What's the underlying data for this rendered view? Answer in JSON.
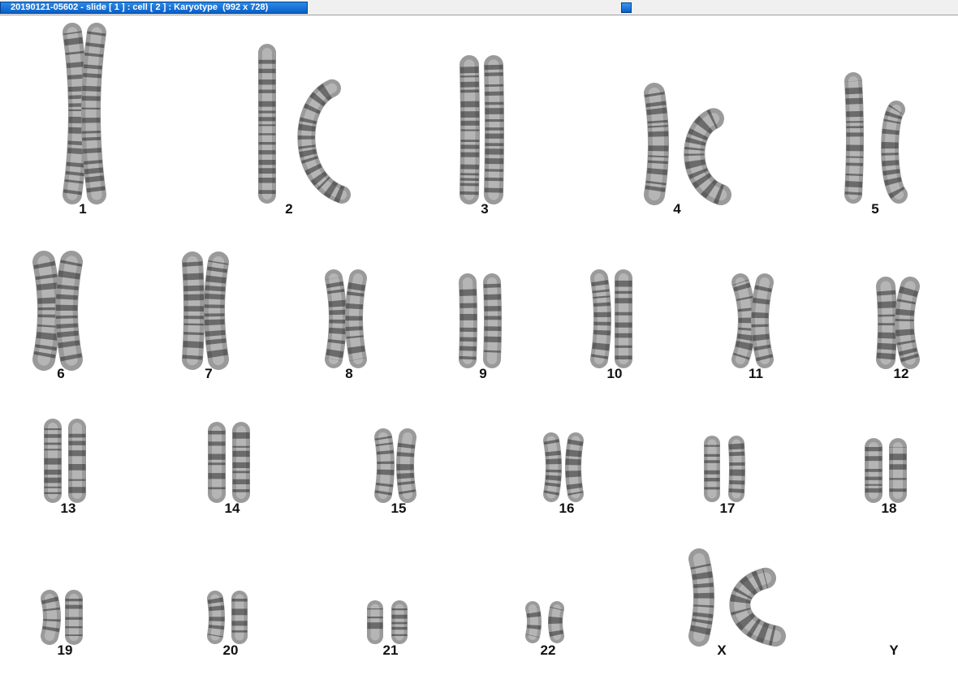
{
  "window": {
    "title": "20190121-05602 - slide [ 1 ] : cell [ 2 ] : Karyotype  (992 x 728)"
  },
  "karyotype": {
    "pairs": [
      {
        "label": "1"
      },
      {
        "label": "2"
      },
      {
        "label": "3"
      },
      {
        "label": "4"
      },
      {
        "label": "5"
      },
      {
        "label": "6"
      },
      {
        "label": "7"
      },
      {
        "label": "8"
      },
      {
        "label": "9"
      },
      {
        "label": "10"
      },
      {
        "label": "11"
      },
      {
        "label": "12"
      },
      {
        "label": "13"
      },
      {
        "label": "14"
      },
      {
        "label": "15"
      },
      {
        "label": "16"
      },
      {
        "label": "17"
      },
      {
        "label": "18"
      },
      {
        "label": "19"
      },
      {
        "label": "20"
      },
      {
        "label": "21"
      },
      {
        "label": "22"
      },
      {
        "label": "X"
      },
      {
        "label": "Y"
      }
    ]
  }
}
